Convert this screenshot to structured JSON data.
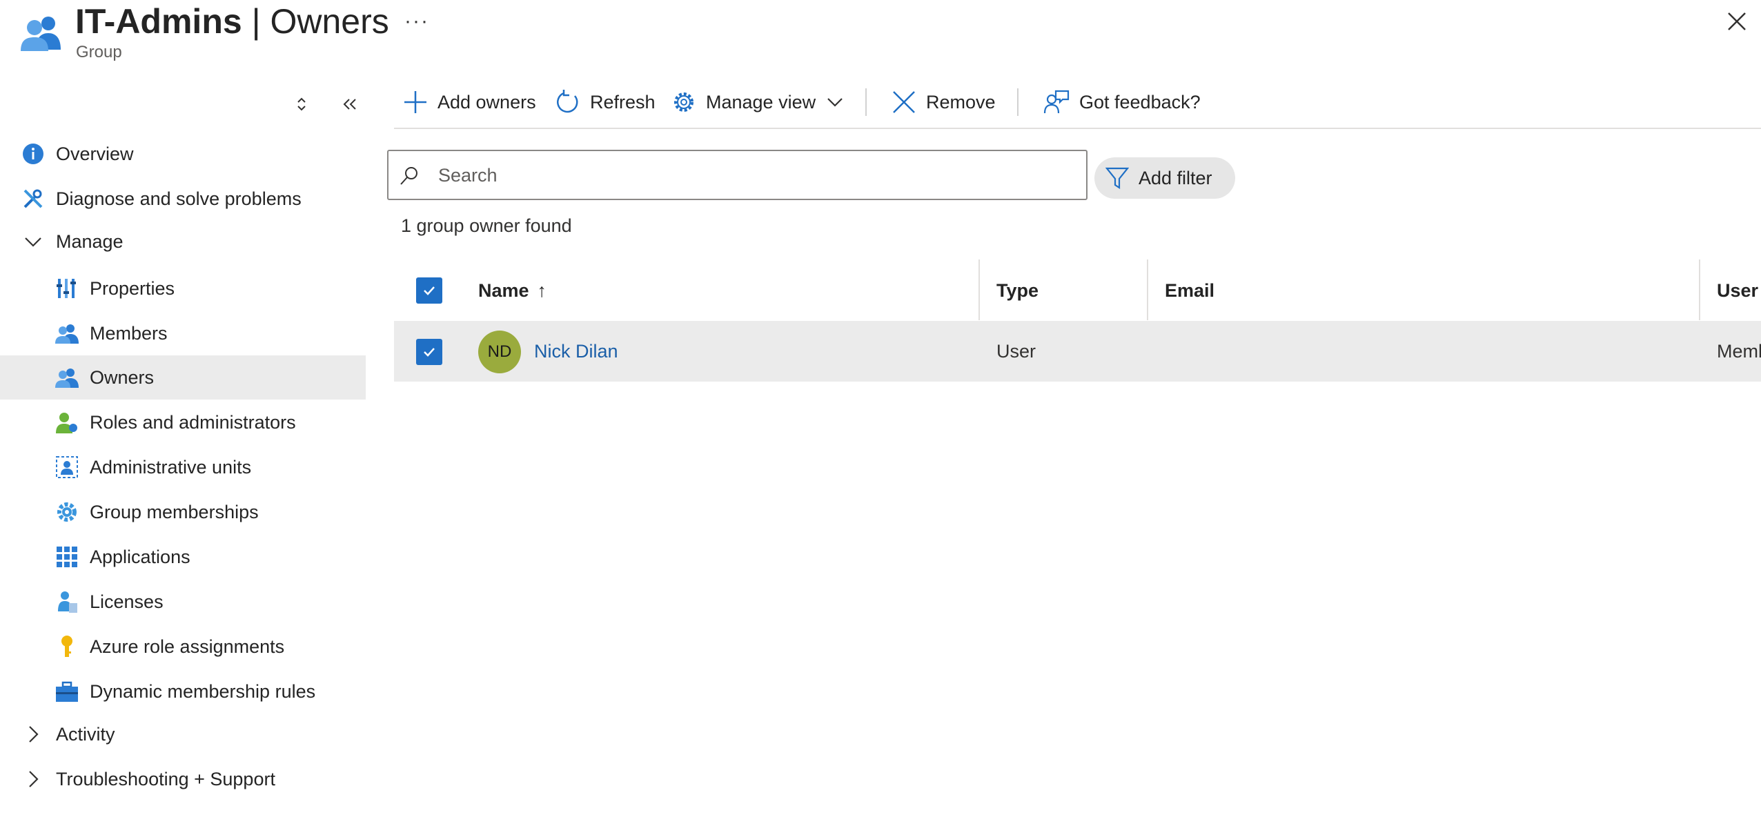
{
  "header": {
    "title_strong": "IT-Admins",
    "title_rest": " | Owners",
    "subtitle": "Group",
    "more_label": "···"
  },
  "sidebar": {
    "items": [
      {
        "label": "Overview",
        "icon": "info-icon",
        "level": "top"
      },
      {
        "label": "Diagnose and solve problems",
        "icon": "wrench-icon",
        "level": "top"
      },
      {
        "label": "Manage",
        "icon": "chevron-down-icon",
        "level": "top",
        "expanded": true
      },
      {
        "label": "Properties",
        "icon": "properties-icon",
        "level": "sub"
      },
      {
        "label": "Members",
        "icon": "members-icon",
        "level": "sub"
      },
      {
        "label": "Owners",
        "icon": "owners-icon",
        "level": "sub",
        "selected": true
      },
      {
        "label": "Roles and administrators",
        "icon": "roles-icon",
        "level": "sub"
      },
      {
        "label": "Administrative units",
        "icon": "admin-units-icon",
        "level": "sub"
      },
      {
        "label": "Group memberships",
        "icon": "gear-icon",
        "level": "sub"
      },
      {
        "label": "Applications",
        "icon": "apps-grid-icon",
        "level": "sub"
      },
      {
        "label": "Licenses",
        "icon": "licenses-icon",
        "level": "sub"
      },
      {
        "label": "Azure role assignments",
        "icon": "key-icon",
        "level": "sub"
      },
      {
        "label": "Dynamic membership rules",
        "icon": "briefcase-icon",
        "level": "sub"
      },
      {
        "label": "Activity",
        "icon": "chevron-right-icon",
        "level": "top",
        "expanded": false
      },
      {
        "label": "Troubleshooting + Support",
        "icon": "chevron-right-icon",
        "level": "top",
        "expanded": false
      }
    ]
  },
  "toolbar": {
    "add_owners": "Add owners",
    "refresh": "Refresh",
    "manage_view": "Manage view",
    "remove": "Remove",
    "feedback": "Got feedback?"
  },
  "search": {
    "placeholder": "Search",
    "value": ""
  },
  "filter": {
    "add_filter": "Add filter"
  },
  "results": {
    "count_text": "1 group owner found"
  },
  "table": {
    "headers": {
      "name": "Name",
      "sort_indicator": "↑",
      "type": "Type",
      "email": "Email",
      "user_type": "User t"
    },
    "rows": [
      {
        "initials": "ND",
        "name": "Nick Dilan",
        "type": "User",
        "email": "",
        "user_type": "Memb",
        "selected": true
      }
    ]
  },
  "colors": {
    "accent": "#1f6fc5",
    "link": "#1b5fa8",
    "avatar": "#9aab3d",
    "selected_row": "#ebebeb"
  }
}
